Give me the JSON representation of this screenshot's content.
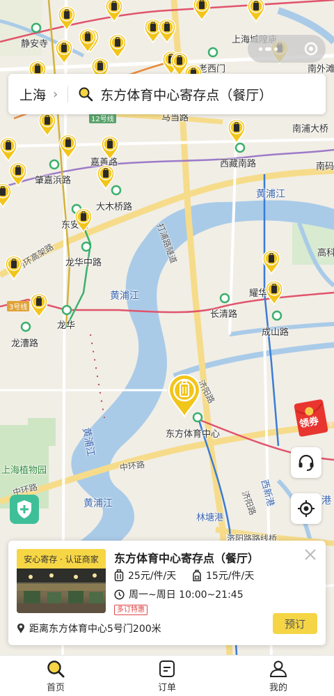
{
  "search": {
    "city": "上海",
    "query": "东方体育中心寄存点（餐厅）"
  },
  "map": {
    "labels": {
      "jingan_temple": "静安寺",
      "city_temple": "上海城隍庙",
      "old_west_gate": "老西门",
      "madang_road": "马当路",
      "nanpu_bridge": "南浦大桥",
      "jiashan_road": "嘉善路",
      "zhaojiabang_road": "肇嘉浜路",
      "xizang_south_road": "西藏南路",
      "line12": "12号线",
      "nanma": "南码",
      "damuqiao_road": "大木桥路",
      "huangpu_river_1": "黄浦江",
      "dongan": "东安路",
      "inner_ring": "内环高架路",
      "longhua_middle": "龙华中路",
      "dapu_tunnel": "打浦路隧道",
      "gaoke": "高科",
      "yaohua": "耀华",
      "huangpu_river_2": "黄浦江",
      "changqing_road": "长清路",
      "line3": "3号线",
      "longhua": "龙华",
      "chengshan_road": "成山路",
      "longcao_road": "龙漕路",
      "jiyang_road": "济阳路",
      "oriental_sports": "东方体育中心",
      "huangpu_river_3": "黄浦江",
      "middle_ring": "中环路",
      "botanical": "上海植物园",
      "middle_ring_2": "中环路",
      "huangpu_river_4": "黄浦江",
      "linpu_port": "林塘港",
      "jiyang_road_2": "济阳路",
      "xixin_port": "西新港",
      "jiyang_tunnel": "济阳路路线桥",
      "nanwaitan": "南外滩",
      "port": "港"
    }
  },
  "coupon": {
    "label": "领券"
  },
  "card": {
    "badge": "安心寄存 · 认证商家",
    "title": "东方体育中心寄存点（餐厅）",
    "price_small": "25元/件/天",
    "price_large": "15元/件/天",
    "hours": "周一~周日 10:00~21:45",
    "discount_tag": "多订特惠",
    "distance": "距离东方体育中心5号门200米",
    "book_label": "预订"
  },
  "nav": {
    "items": [
      {
        "label": "首页",
        "active": true
      },
      {
        "label": "订单",
        "active": false
      },
      {
        "label": "我的",
        "active": false
      }
    ]
  },
  "colors": {
    "accent": "#f5d545",
    "pin_fill": "#f2c51a",
    "pin_body": "#2a2a2a",
    "water": "#a9cbe8",
    "discount": "#e04545"
  }
}
